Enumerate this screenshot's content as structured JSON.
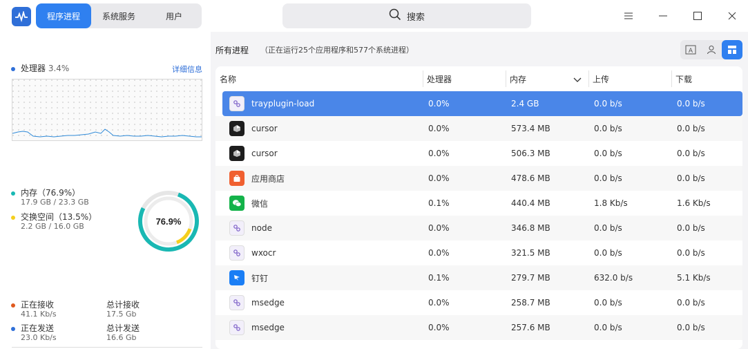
{
  "header": {
    "tabs": [
      {
        "label": "程序进程",
        "active": true
      },
      {
        "label": "系统服务",
        "active": false
      },
      {
        "label": "用户",
        "active": false
      }
    ],
    "search_label": "搜索",
    "colors": {
      "accent": "#2f80f0",
      "selected_row": "#4a86e8"
    }
  },
  "left": {
    "cpu_label": "处理器",
    "cpu_value": "3.4%",
    "cpu_detail": "详细信息",
    "memory_label": "内存（76.9%）",
    "memory_value": "17.9  GB  /  23.3  GB",
    "swap_label": "交换空间（13.5%）",
    "swap_value": "2.2  GB  /  16.0  GB",
    "donut_label": "76.9%",
    "donut_fraction": 0.769,
    "swap_fraction": 0.135,
    "recv_label": "正在接收",
    "recv_value": "41.1  Kb/s",
    "total_recv_label": "总计接收",
    "total_recv_value": "17.5  Gb",
    "send_label": "正在发送",
    "send_value": "23.0  Kb/s",
    "total_send_label": "总计发送",
    "total_send_value": "16.6  Gb"
  },
  "right": {
    "title": "所有进程",
    "subtitle": "（正在运行25个应用程序和577个系统进程）",
    "columns": [
      "名称",
      "处理器",
      "内存",
      "上传",
      "下载"
    ],
    "rows": [
      {
        "name": "trayplugin-load",
        "icon": "generic-process-icon",
        "cpu": "0.0%",
        "mem": "2.4  GB",
        "up": "0.0  b/s",
        "down": "0.0  b/s"
      },
      {
        "name": "cursor",
        "icon": "cursor-app-icon",
        "cpu": "0.0%",
        "mem": "573.4  MB",
        "up": "0.0  b/s",
        "down": "0.0  b/s"
      },
      {
        "name": "cursor",
        "icon": "cursor-app-icon",
        "cpu": "0.0%",
        "mem": "506.3  MB",
        "up": "0.0  b/s",
        "down": "0.0  b/s"
      },
      {
        "name": "应用商店",
        "icon": "app-store-icon",
        "cpu": "0.0%",
        "mem": "478.6  MB",
        "up": "0.0  b/s",
        "down": "0.0  b/s"
      },
      {
        "name": "微信",
        "icon": "wechat-icon",
        "cpu": "0.1%",
        "mem": "440.4  MB",
        "up": "1.8  Kb/s",
        "down": "1.6  Kb/s"
      },
      {
        "name": "node",
        "icon": "generic-process-icon",
        "cpu": "0.0%",
        "mem": "346.8  MB",
        "up": "0.0  b/s",
        "down": "0.0  b/s"
      },
      {
        "name": "wxocr",
        "icon": "generic-process-icon",
        "cpu": "0.0%",
        "mem": "321.5  MB",
        "up": "0.0  b/s",
        "down": "0.0  b/s"
      },
      {
        "name": "钉钉",
        "icon": "dingtalk-icon",
        "cpu": "0.1%",
        "mem": "279.7  MB",
        "up": "632.0  b/s",
        "down": "5.1  Kb/s"
      },
      {
        "name": "msedge",
        "icon": "generic-process-icon",
        "cpu": "0.0%",
        "mem": "258.7  MB",
        "up": "0.0  b/s",
        "down": "0.0  b/s"
      },
      {
        "name": "msedge",
        "icon": "generic-process-icon",
        "cpu": "0.0%",
        "mem": "257.6  MB",
        "up": "0.0  b/s",
        "down": "0.0  b/s"
      }
    ]
  }
}
